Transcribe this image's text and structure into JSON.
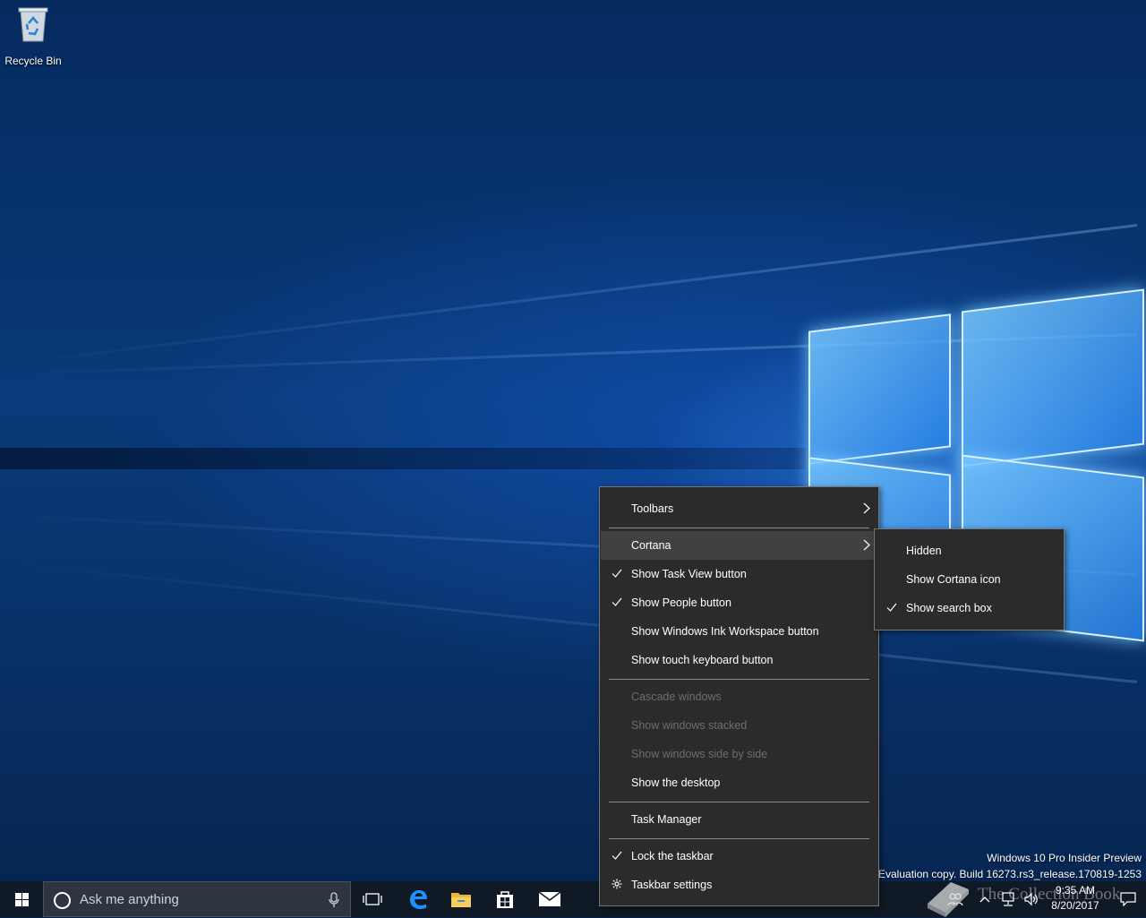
{
  "desktop": {
    "recycle_bin_label": "Recycle Bin"
  },
  "watermark": {
    "line1": "Windows 10 Pro Insider Preview",
    "line2": "Evaluation copy. Build 16273.rs3_release.170819-1253"
  },
  "context_menu": {
    "toolbars": "Toolbars",
    "cortana": "Cortana",
    "show_task_view": "Show Task View button",
    "show_people": "Show People button",
    "show_ink_workspace": "Show Windows Ink Workspace button",
    "show_touch_keyboard": "Show touch keyboard button",
    "cascade_windows": "Cascade windows",
    "show_windows_stacked": "Show windows stacked",
    "show_windows_side_by_side": "Show windows side by side",
    "show_desktop": "Show the desktop",
    "task_manager": "Task Manager",
    "lock_taskbar": "Lock the taskbar",
    "taskbar_settings": "Taskbar settings",
    "checked": [
      "show_task_view",
      "show_people",
      "lock_taskbar"
    ],
    "disabled": [
      "cascade_windows",
      "show_windows_stacked",
      "show_windows_side_by_side"
    ],
    "highlighted": "cortana"
  },
  "cortana_submenu": {
    "hidden": "Hidden",
    "show_cortana_icon": "Show Cortana icon",
    "show_search_box": "Show search box",
    "checked": "show_search_box"
  },
  "taskbar": {
    "search_placeholder": "Ask me anything",
    "pinned_icons": [
      "task-view-icon",
      "edge-icon",
      "file-explorer-icon",
      "store-icon",
      "mail-icon"
    ],
    "tray_icons": [
      "people-icon",
      "show-hidden-icons-icon",
      "network-icon",
      "volume-icon"
    ],
    "time": "9:35 AM",
    "date": "8/20/2017"
  },
  "overlay": {
    "brand_text": "The Collection Book"
  },
  "colors": {
    "menu_bg": "#2b2b2b",
    "menu_highlight": "#414141",
    "taskbar_bg": "#0f1a26",
    "accent_blue": "#1e90ff"
  }
}
